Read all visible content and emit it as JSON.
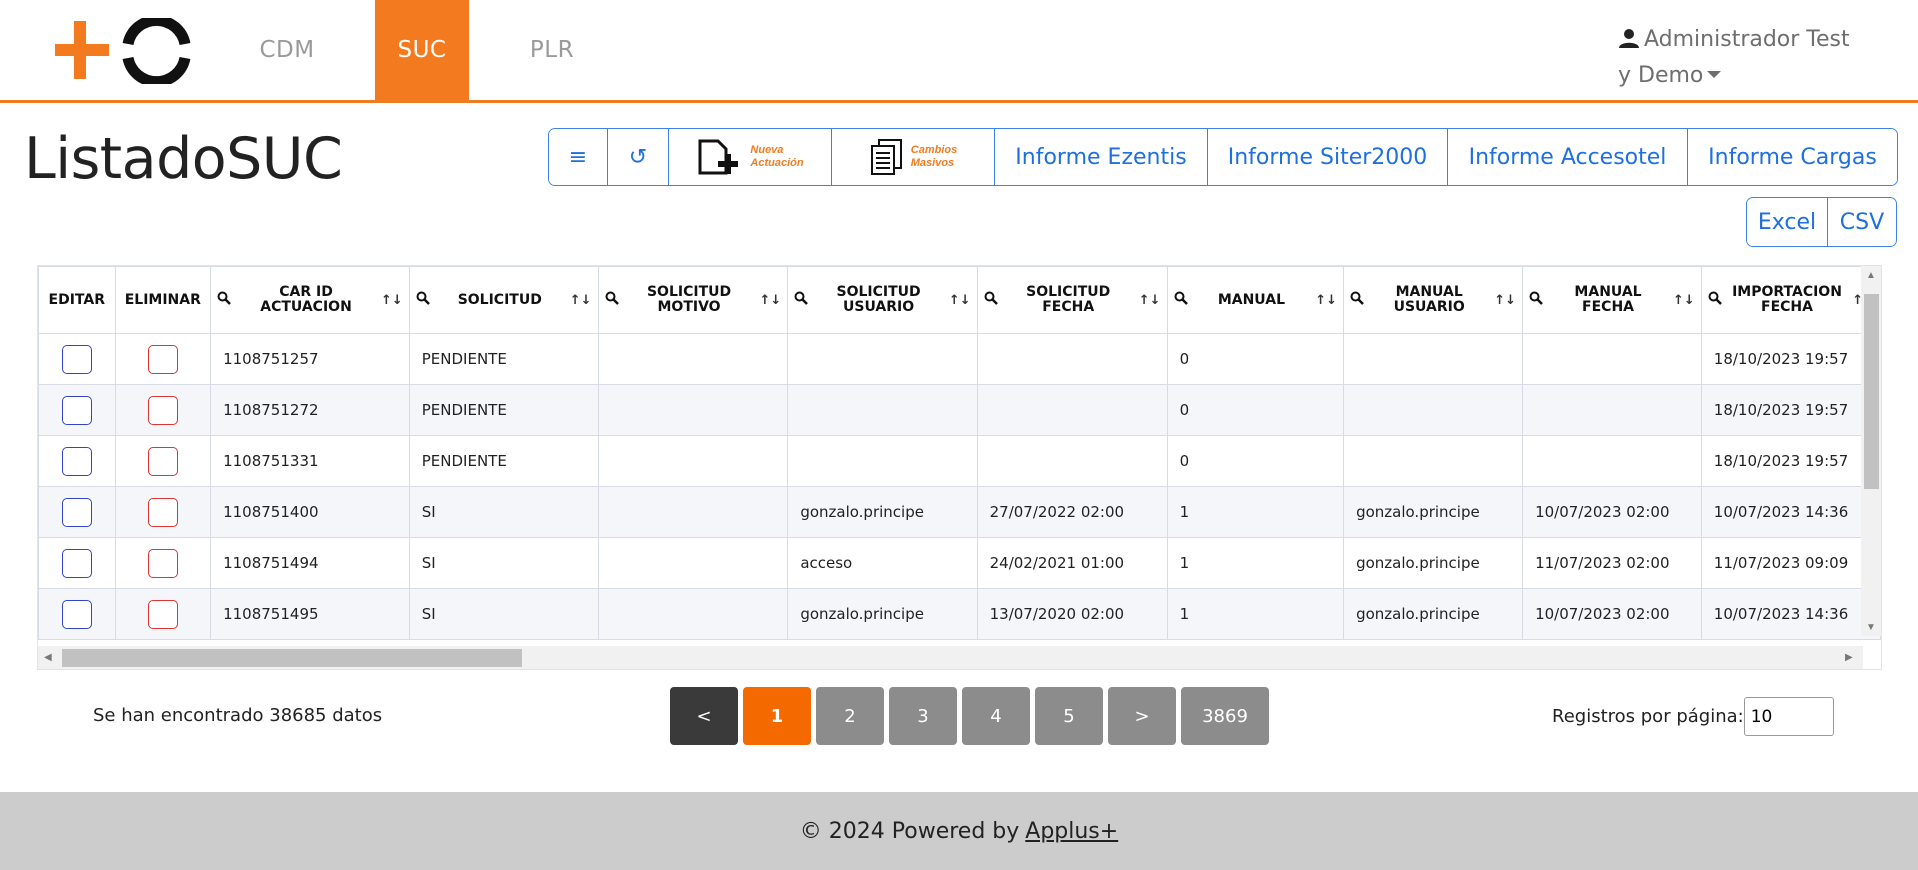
{
  "nav": {
    "tabs": [
      {
        "label": "CDM",
        "active": false
      },
      {
        "label": "SUC",
        "active": true
      },
      {
        "label": "PLR",
        "active": false
      }
    ],
    "user": {
      "name_line1": "Administrador Test",
      "name_line2": "y Demo"
    }
  },
  "page": {
    "title": "ListadoSUC"
  },
  "toolbar": {
    "menu_icon": "≡",
    "refresh_icon": "↺",
    "nueva_actuacion": {
      "line1": "Nueva",
      "line2": "Actuación"
    },
    "cambios_masivos": {
      "line1": "Cambios",
      "line2": "Masivos"
    },
    "reports": [
      "Informe Ezentis",
      "Informe Siter2000",
      "Informe Accesotel",
      "Informe Cargas"
    ],
    "export": [
      "Excel",
      "CSV"
    ]
  },
  "table": {
    "columns": [
      {
        "label": "EDITAR",
        "searchable": false,
        "sortable": false
      },
      {
        "label": "ELIMINAR",
        "searchable": false,
        "sortable": false
      },
      {
        "label": "CAR ID ACTUACION",
        "searchable": true,
        "sortable": true
      },
      {
        "label": "SOLICITUD",
        "searchable": true,
        "sortable": true
      },
      {
        "label": "SOLICITUD MOTIVO",
        "searchable": true,
        "sortable": true
      },
      {
        "label": "SOLICITUD USUARIO",
        "searchable": true,
        "sortable": true
      },
      {
        "label": "SOLICITUD FECHA",
        "searchable": true,
        "sortable": true
      },
      {
        "label": "MANUAL",
        "searchable": true,
        "sortable": true
      },
      {
        "label": "MANUAL USUARIO",
        "searchable": true,
        "sortable": true
      },
      {
        "label": "MANUAL FECHA",
        "searchable": true,
        "sortable": true
      },
      {
        "label": "IMPORTACION FECHA",
        "searchable": true,
        "sortable": true
      }
    ],
    "rows": [
      [
        "1108751257",
        "PENDIENTE",
        "",
        "",
        "",
        "0",
        "",
        "",
        "18/10/2023 19:57"
      ],
      [
        "1108751272",
        "PENDIENTE",
        "",
        "",
        "",
        "0",
        "",
        "",
        "18/10/2023 19:57"
      ],
      [
        "1108751331",
        "PENDIENTE",
        "",
        "",
        "",
        "0",
        "",
        "",
        "18/10/2023 19:57"
      ],
      [
        "1108751400",
        "SI",
        "",
        "gonzalo.principe",
        "27/07/2022 02:00",
        "1",
        "gonzalo.principe",
        "10/07/2023 02:00",
        "10/07/2023 14:36"
      ],
      [
        "1108751494",
        "SI",
        "",
        "acceso",
        "24/02/2021 01:00",
        "1",
        "gonzalo.principe",
        "11/07/2023 02:00",
        "11/07/2023 09:09"
      ],
      [
        "1108751495",
        "SI",
        "",
        "gonzalo.principe",
        "13/07/2020 02:00",
        "1",
        "gonzalo.principe",
        "10/07/2023 02:00",
        "10/07/2023 14:36"
      ]
    ]
  },
  "summary": {
    "found_text": "Se han encontrado 38685 datos"
  },
  "pagination": {
    "prev": "<",
    "pages": [
      "1",
      "2",
      "3",
      "4",
      "5"
    ],
    "active_page": "1",
    "next": ">",
    "last": "3869"
  },
  "per_page": {
    "label": "Registros por página:",
    "value": "10"
  },
  "footer": {
    "text": "© 2024 Powered by",
    "link": "Applus+"
  },
  "colors": {
    "brand_orange": "#f47a1f",
    "link_blue": "#1e6fe0",
    "edit_border": "#3344cc",
    "delete_border": "#e03333"
  }
}
